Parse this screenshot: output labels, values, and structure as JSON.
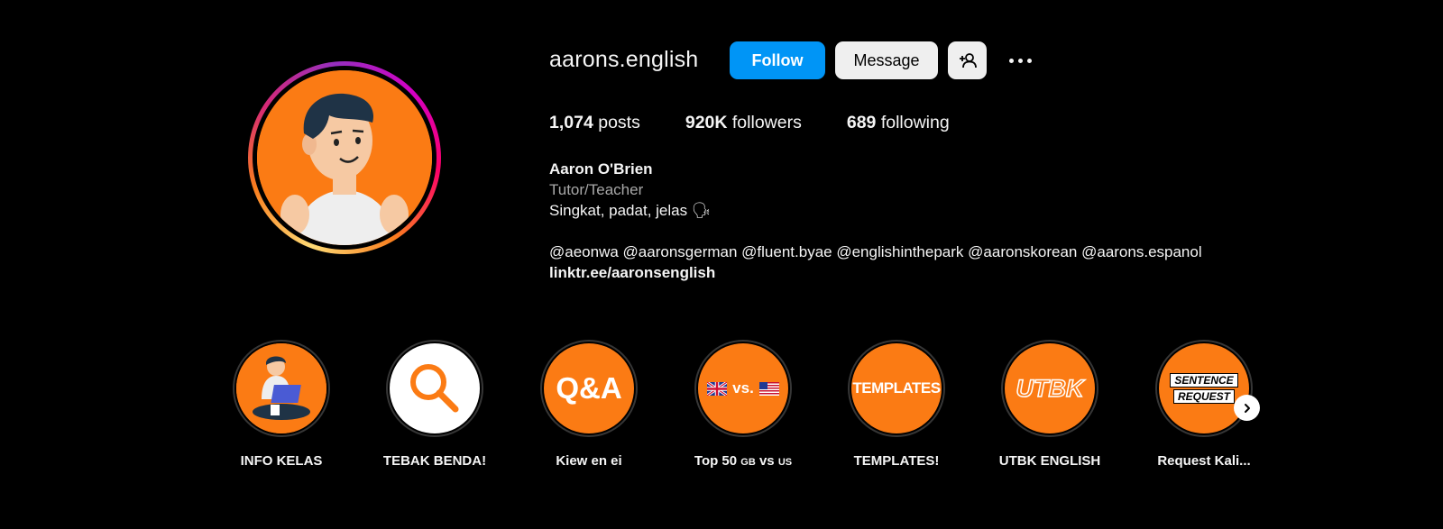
{
  "profile": {
    "username": "aarons.english",
    "follow_label": "Follow",
    "message_label": "Message",
    "more_icon": "more-horizontal-icon",
    "suggest_icon": "add-person-icon"
  },
  "stats": {
    "posts_count": "1,074",
    "posts_label": "posts",
    "followers_count": "920K",
    "followers_label": "followers",
    "following_count": "689",
    "following_label": "following"
  },
  "bio": {
    "name": "Aaron O'Brien",
    "category": "Tutor/Teacher",
    "tagline": "Singkat, padat, jelas 🗣",
    "mentions": [
      "@aeonwa",
      "@aaronsgerman",
      "@fluent.byae",
      "@englishinthepark",
      "@aaronskorean",
      "@aarons.espanol"
    ],
    "link": "linktr.ee/aaronsenglish"
  },
  "highlights": [
    {
      "label": "INFO KELAS"
    },
    {
      "label": "TEBAK BENDA!"
    },
    {
      "label": "Kiew en ei",
      "cover_text": "Q&A"
    },
    {
      "label_main": "Top 50 ",
      "label_gb": "GB",
      "label_mid": " vs ",
      "label_us": "US",
      "cover_text": "vs."
    },
    {
      "label": "TEMPLATES!",
      "cover_text": "TEMPLATES"
    },
    {
      "label": "UTBK ENGLISH",
      "cover_text": "UTBK"
    },
    {
      "label": "Request Kali...",
      "cover_line1": "SENTENCE",
      "cover_line2": "REQUEST"
    }
  ],
  "colors": {
    "background": "#000000",
    "follow_button": "#0095f6",
    "accent_orange": "#fb7b14",
    "secondary_text": "#a8a8a8"
  }
}
